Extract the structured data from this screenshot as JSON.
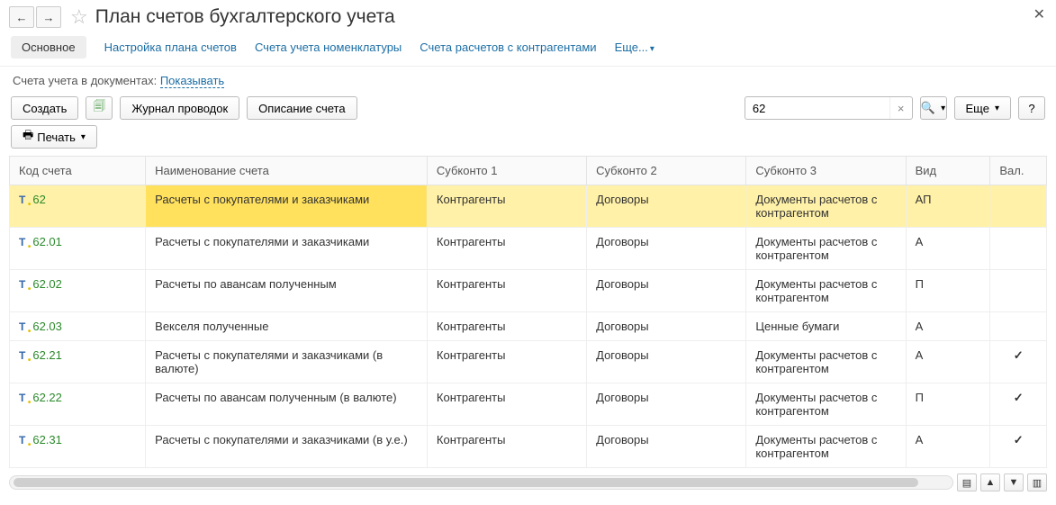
{
  "header": {
    "title": "План счетов бухгалтерского учета"
  },
  "tabs": {
    "main": "Основное",
    "t1": "Настройка плана счетов",
    "t2": "Счета учета номенклатуры",
    "t3": "Счета расчетов с контрагентами",
    "more": "Еще..."
  },
  "docrow": {
    "label": "Счета учета в документах:",
    "link": "Показывать"
  },
  "toolbar": {
    "create": "Создать",
    "journal": "Журнал проводок",
    "desc": "Описание счета",
    "search_value": "62",
    "more": "Еще",
    "print": "Печать"
  },
  "columns": {
    "code": "Код счета",
    "name": "Наименование счета",
    "sub1": "Субконто 1",
    "sub2": "Субконто 2",
    "sub3": "Субконто 3",
    "kind": "Вид",
    "val": "Вал."
  },
  "rows": [
    {
      "code": "62",
      "name": "Расчеты с покупателями и заказчиками",
      "s1": "Контрагенты",
      "s2": "Договоры",
      "s3": "Документы расчетов с контрагентом",
      "kind": "АП",
      "val": "",
      "selected": true
    },
    {
      "code": "62.01",
      "name": "Расчеты с покупателями и заказчиками",
      "s1": "Контрагенты",
      "s2": "Договоры",
      "s3": "Документы расчетов с контрагентом",
      "kind": "А",
      "val": ""
    },
    {
      "code": "62.02",
      "name": "Расчеты по авансам полученным",
      "s1": "Контрагенты",
      "s2": "Договоры",
      "s3": "Документы расчетов с контрагентом",
      "kind": "П",
      "val": ""
    },
    {
      "code": "62.03",
      "name": "Векселя полученные",
      "s1": "Контрагенты",
      "s2": "Договоры",
      "s3": "Ценные бумаги",
      "kind": "А",
      "val": ""
    },
    {
      "code": "62.21",
      "name": "Расчеты с покупателями и заказчиками (в валюте)",
      "s1": "Контрагенты",
      "s2": "Договоры",
      "s3": "Документы расчетов с контрагентом",
      "kind": "А",
      "val": "✓"
    },
    {
      "code": "62.22",
      "name": "Расчеты по авансам полученным (в валюте)",
      "s1": "Контрагенты",
      "s2": "Договоры",
      "s3": "Документы расчетов с контрагентом",
      "kind": "П",
      "val": "✓"
    },
    {
      "code": "62.31",
      "name": "Расчеты с покупателями и заказчиками (в у.е.)",
      "s1": "Контрагенты",
      "s2": "Договоры",
      "s3": "Документы расчетов с контрагентом",
      "kind": "А",
      "val": "✓"
    }
  ]
}
